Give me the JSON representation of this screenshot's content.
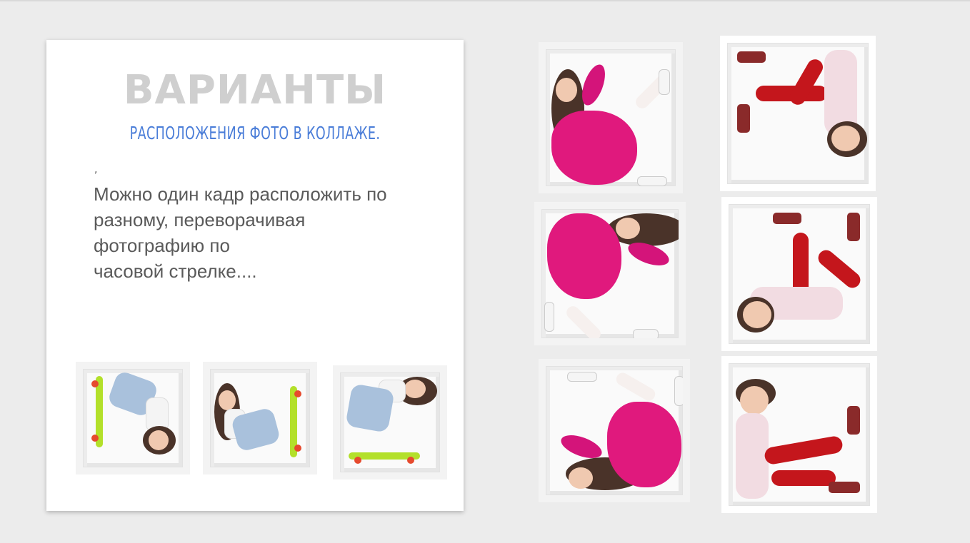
{
  "card": {
    "title": "ВАРИАНТЫ",
    "subtitle": "РАСПОЛОЖЕНИЯ ФОТО В КОЛЛАЖЕ.",
    "comma": ",",
    "body_lines": [
      "Можно один кадр расположить по",
      "разному, переворачивая",
      "фотографию по",
      "часовой стрелке...."
    ]
  },
  "colors": {
    "background": "#ececec",
    "title": "#cfcfcf",
    "subtitle": "#4a7dd8",
    "body": "#5a5a5a",
    "dress": "#e0197d",
    "pants": "#c4161c",
    "skateboard": "#b3e02a"
  },
  "photos": {
    "small": [
      "girl-skateboard-photo-1",
      "girl-skateboard-photo-2",
      "girl-skateboard-photo-3"
    ],
    "girl_column": [
      "girl-pink-dress-photo-1",
      "girl-pink-dress-photo-2",
      "girl-pink-dress-photo-3"
    ],
    "boy_column": [
      "boy-red-pants-photo-1",
      "boy-red-pants-photo-2",
      "boy-red-pants-photo-3"
    ]
  }
}
